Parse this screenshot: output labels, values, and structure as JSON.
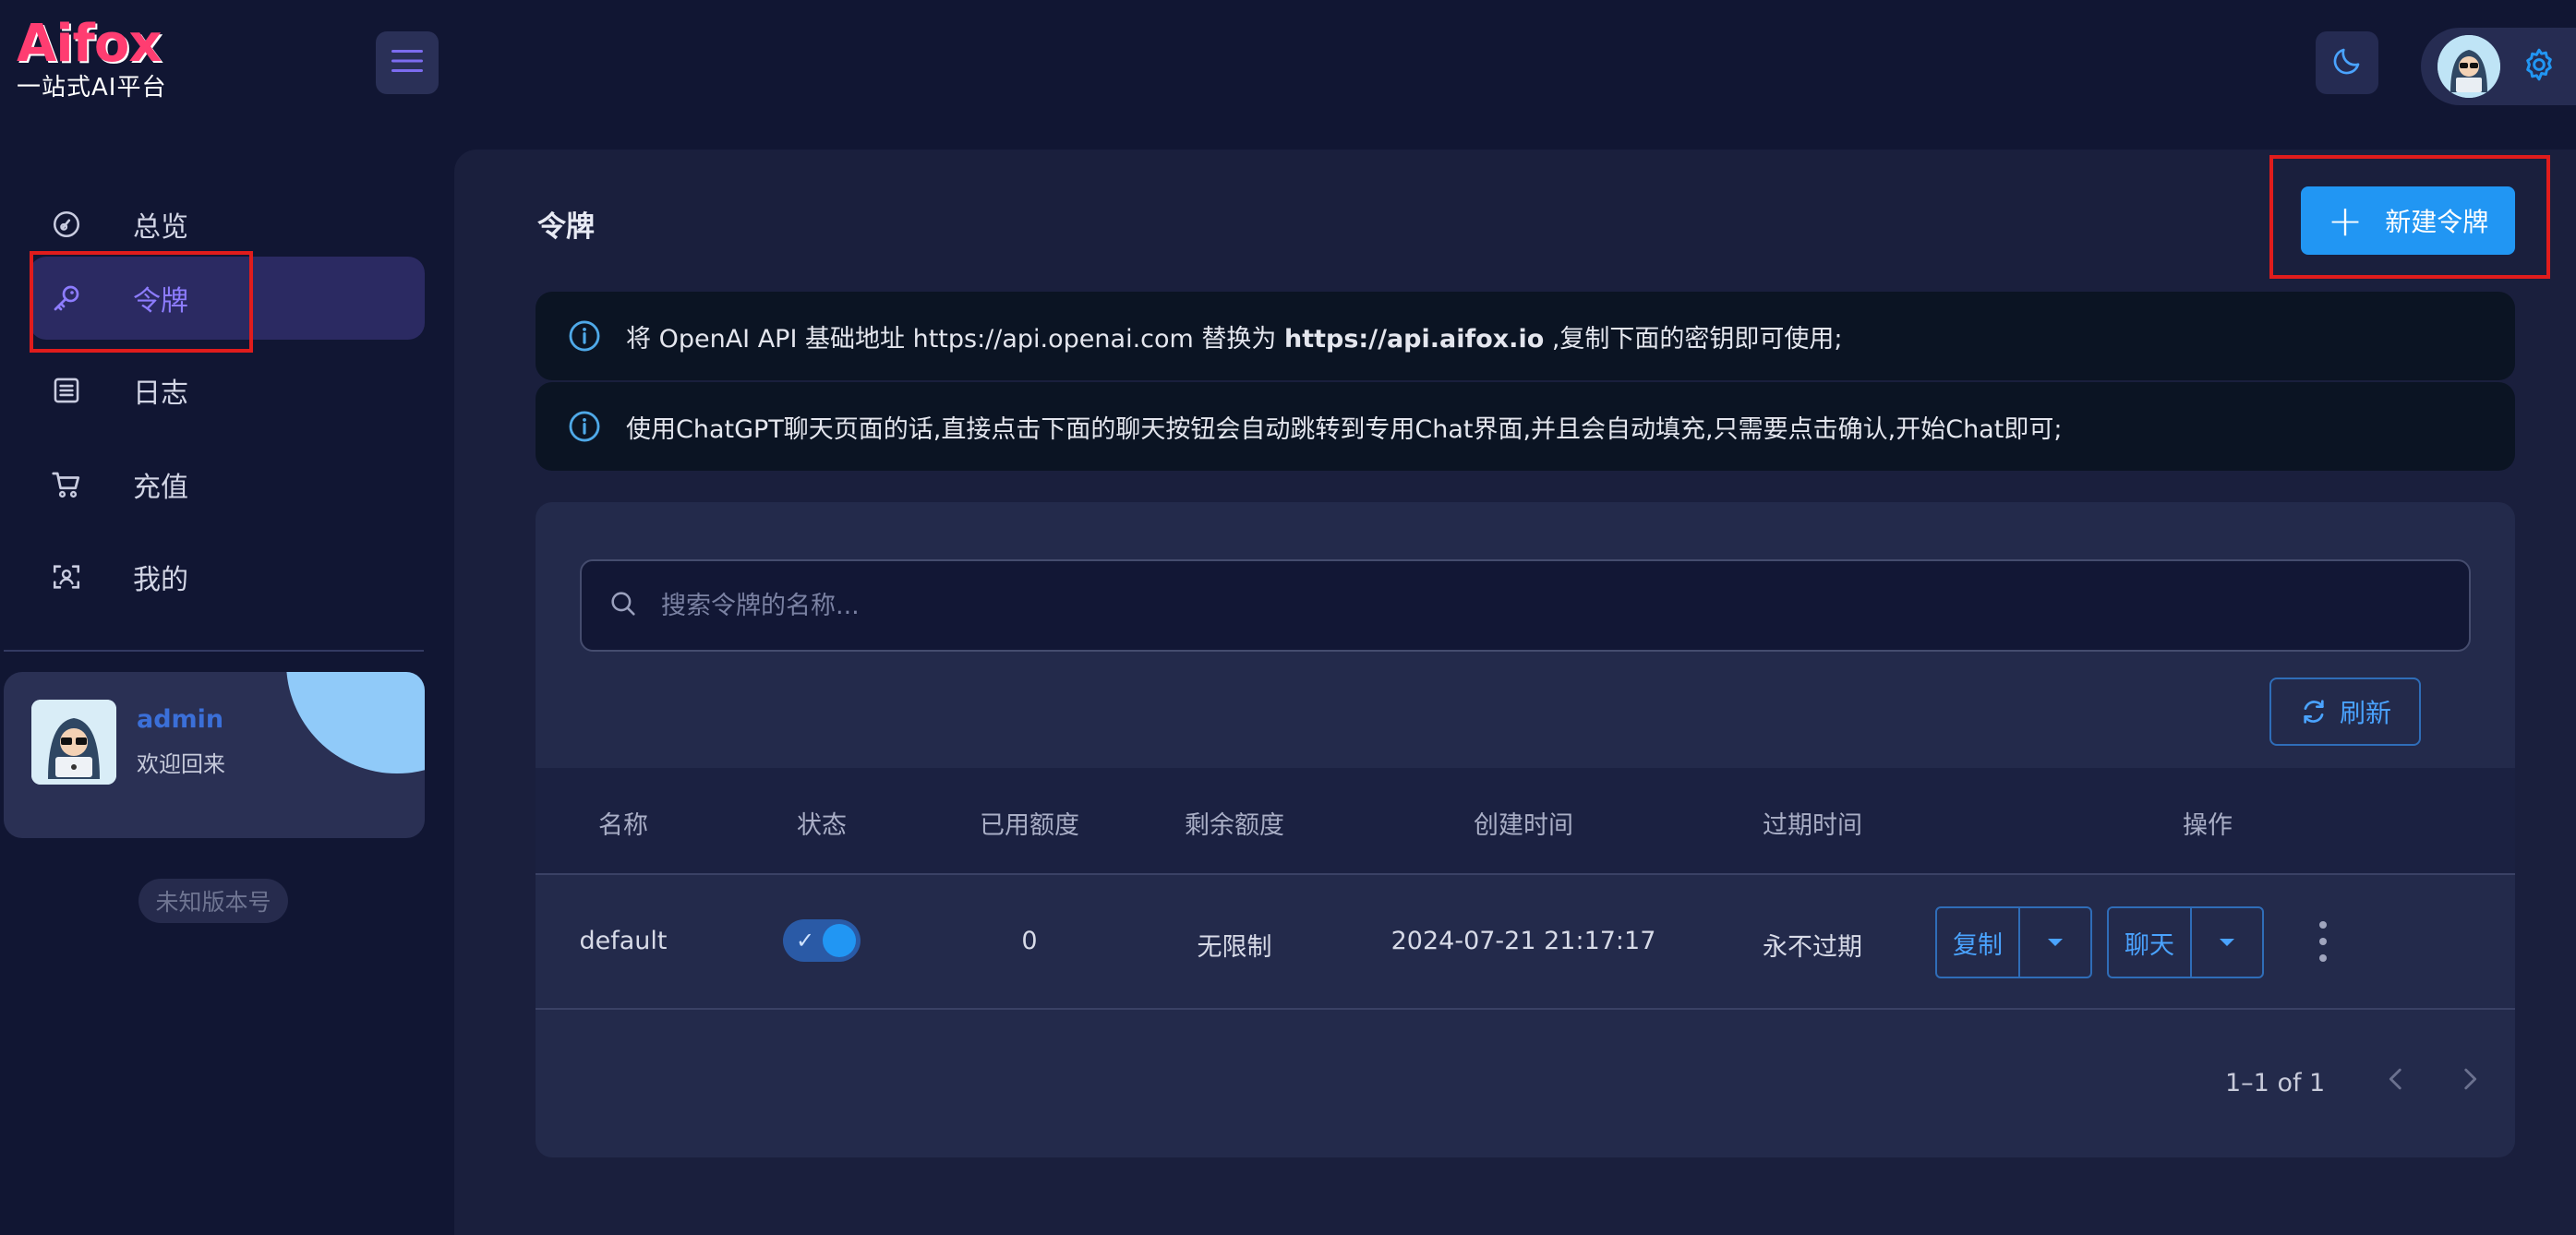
{
  "brand": {
    "logo_text": "Aifox",
    "tagline": "一站式AI平台"
  },
  "header": {
    "menu_icon": "hamburger-icon",
    "theme_icon": "moon-icon",
    "settings_icon": "gear-icon"
  },
  "sidebar": {
    "items": [
      {
        "label": "总览",
        "icon": "dashboard-icon"
      },
      {
        "label": "令牌",
        "icon": "key-icon",
        "active": true
      },
      {
        "label": "日志",
        "icon": "document-list-icon"
      },
      {
        "label": "充值",
        "icon": "cart-icon"
      },
      {
        "label": "我的",
        "icon": "user-scan-icon"
      }
    ],
    "user": {
      "name": "admin",
      "welcome": "欢迎回来"
    },
    "version": "未知版本号"
  },
  "main": {
    "title": "令牌",
    "new_button": "新建令牌",
    "alerts": {
      "first_prefix": "将 OpenAI API 基础地址 https://api.openai.com 替换为 ",
      "first_bold": "https://api.aifox.io",
      "first_suffix": " ,复制下面的密钥即可使用;",
      "second": "使用ChatGPT聊天页面的话,直接点击下面的聊天按钮会自动跳转到专用Chat界面,并且会自动填充,只需要点击确认,开始Chat即可;"
    },
    "search": {
      "placeholder": "搜索令牌的名称...",
      "value": ""
    },
    "refresh_button": "刷新",
    "table": {
      "headers": [
        "名称",
        "状态",
        "已用额度",
        "剩余额度",
        "创建时间",
        "过期时间",
        "操作"
      ],
      "rows": [
        {
          "name": "default",
          "enabled": true,
          "used": "0",
          "remaining": "无限制",
          "created": "2024-07-21 21:17:17",
          "expires": "永不过期",
          "copy": "复制",
          "chat": "聊天"
        }
      ]
    },
    "pagination": "1–1 of 1"
  },
  "colors": {
    "accent": "#2196f3",
    "active_nav": "#8d7cff",
    "highlight": "#e01c1c",
    "brand": "#ff3d71"
  }
}
